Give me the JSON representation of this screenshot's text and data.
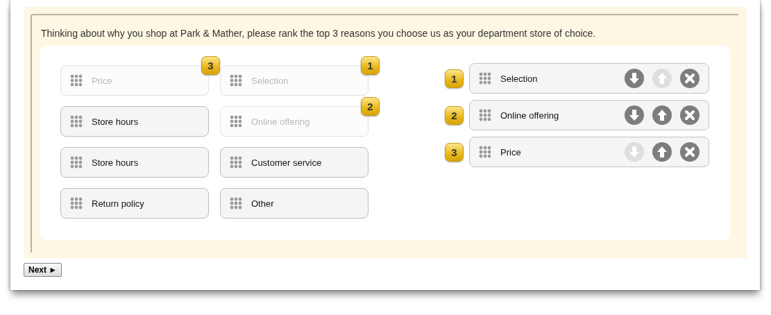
{
  "question": "Thinking about why you shop at Park & Mather, please rank the top 3 reasons you choose us as your department store of choice.",
  "choices": [
    {
      "label": "Price",
      "placed": true,
      "rank": "3"
    },
    {
      "label": "Store hours",
      "placed": false
    },
    {
      "label": "Store hours",
      "placed": false
    },
    {
      "label": "Return policy",
      "placed": false
    },
    {
      "label": "Selection",
      "placed": true,
      "rank": "1"
    },
    {
      "label": "Online offering",
      "placed": true,
      "rank": "2"
    },
    {
      "label": "Customer service",
      "placed": false
    },
    {
      "label": "Other",
      "placed": false
    }
  ],
  "ranking": [
    {
      "rank": "1",
      "label": "Selection",
      "down_disabled": false,
      "up_disabled": true
    },
    {
      "rank": "2",
      "label": "Online offering",
      "down_disabled": false,
      "up_disabled": false
    },
    {
      "rank": "3",
      "label": "Price",
      "down_disabled": true,
      "up_disabled": false
    }
  ],
  "next_button": {
    "label": "Next ►"
  }
}
